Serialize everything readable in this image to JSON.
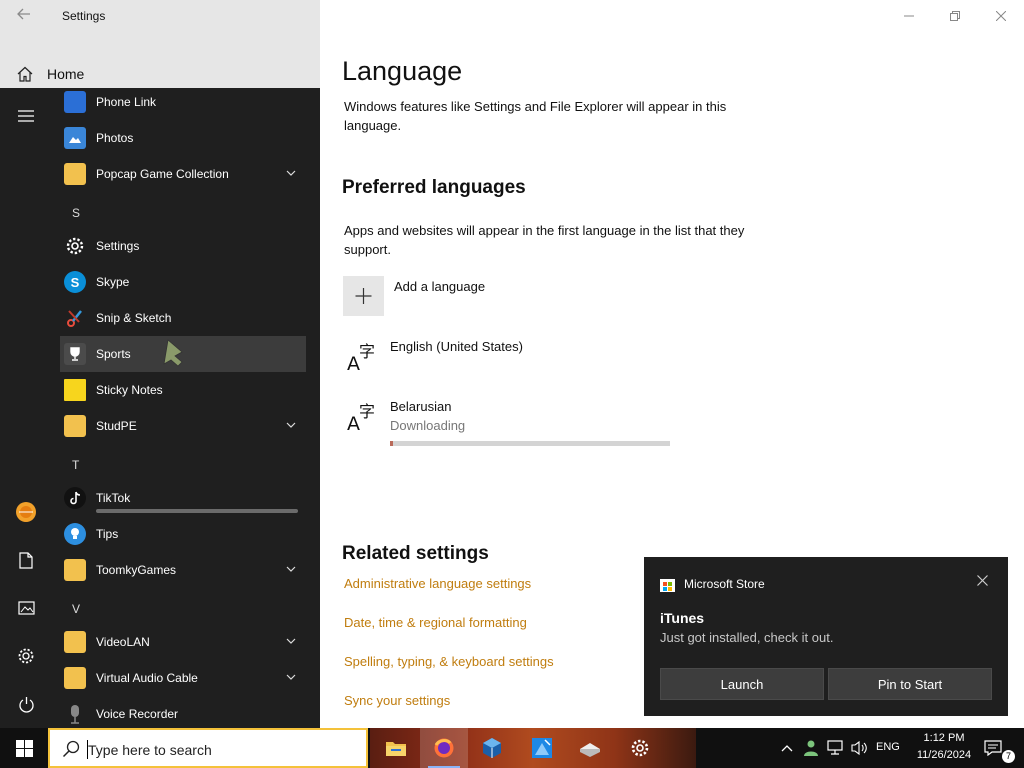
{
  "settings": {
    "title": "Settings",
    "home_label": "Home"
  },
  "start_menu": {
    "apps": [
      {
        "label": "Phone Link",
        "icon": "phone-link-icon",
        "color": "#2b6fd6"
      },
      {
        "label": "Photos",
        "icon": "photos-icon",
        "color": "#3a86d8"
      },
      {
        "label": "Popcap Game Collection",
        "icon": "folder-icon",
        "color": "#f2c14e"
      },
      {
        "label": "Settings",
        "icon": "settings-gear-icon",
        "color": "#1f1f1f"
      },
      {
        "label": "Skype",
        "icon": "skype-icon",
        "color": "#0a8fd8"
      },
      {
        "label": "Snip & Sketch",
        "icon": "snip-sketch-icon",
        "color": "#c0392b"
      },
      {
        "label": "Sports",
        "icon": "trophy-icon",
        "color": "#4b4b4b"
      },
      {
        "label": "Sticky Notes",
        "icon": "sticky-notes-icon",
        "color": "#f7d51d"
      },
      {
        "label": "StudPE",
        "icon": "folder-icon",
        "color": "#f2c14e"
      },
      {
        "label": "TikTok",
        "icon": "tiktok-icon",
        "color": "#111111"
      },
      {
        "label": "Tips",
        "icon": "tips-bulb-icon",
        "color": "#2d8fe0"
      },
      {
        "label": "ToomkyGames",
        "icon": "folder-icon",
        "color": "#f2c14e"
      },
      {
        "label": "VideoLAN",
        "icon": "folder-icon",
        "color": "#f2c14e"
      },
      {
        "label": "Virtual Audio Cable",
        "icon": "folder-icon",
        "color": "#f2c14e"
      },
      {
        "label": "Voice Recorder",
        "icon": "microphone-icon",
        "color": "#555555"
      }
    ],
    "letters": [
      "S",
      "T",
      "V"
    ]
  },
  "language_page": {
    "title": "Language",
    "description": "Windows features like Settings and File Explorer will appear in this language.",
    "preferred_heading": "Preferred languages",
    "preferred_description": "Apps and websites will appear in the first language in the list that they support.",
    "add_language_label": "Add a language",
    "languages": [
      {
        "name": "English (United States)"
      },
      {
        "name": "Belarusian",
        "status": "Downloading",
        "progress_percent": 1
      }
    ],
    "related_heading": "Related settings",
    "related_links": [
      "Administrative language settings",
      "Date, time & regional formatting",
      "Spelling, typing, & keyboard settings",
      "Sync your settings"
    ]
  },
  "toast": {
    "app_name": "Microsoft Store",
    "title": "iTunes",
    "body": "Just got installed, check it out.",
    "launch_label": "Launch",
    "pin_label": "Pin to Start"
  },
  "taskbar": {
    "search_placeholder": "Type here to search",
    "apps": [
      "file-explorer-icon",
      "firefox-icon",
      "virtualbox-icon",
      "app-installer-icon",
      "books-icon",
      "settings-gear-icon"
    ],
    "language": "ENG",
    "time": "1:12 PM",
    "date": "11/26/2024",
    "notification_count": "7"
  },
  "colors": {
    "accent_link": "#c07d0f",
    "start_bg": "#1f1f1f",
    "search_border": "#f4c23a",
    "download_fill": "#b96a5a"
  }
}
